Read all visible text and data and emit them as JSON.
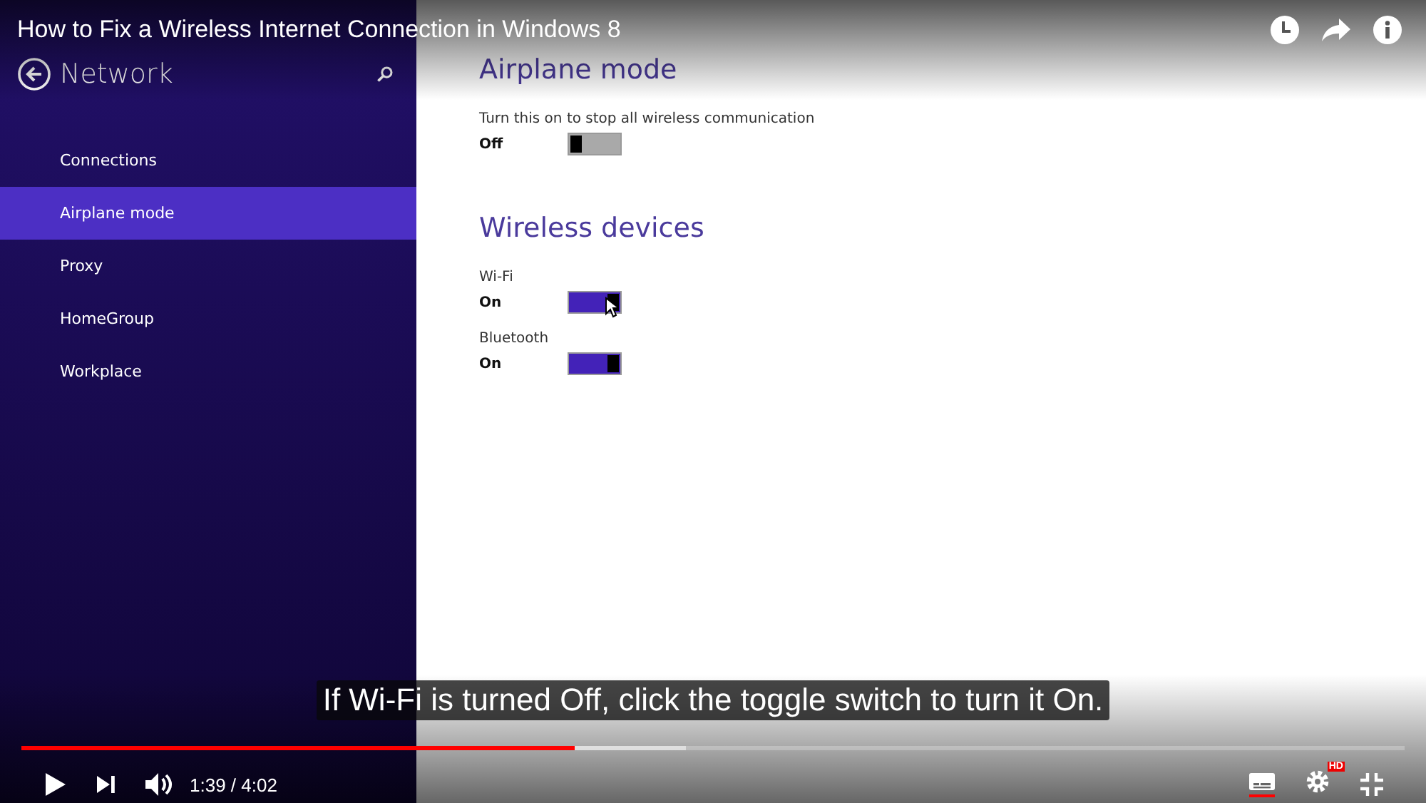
{
  "video": {
    "title": "How to Fix a Wireless Internet Connection in Windows 8"
  },
  "sidebar": {
    "title": "Network",
    "items": [
      {
        "label": "Connections",
        "selected": false
      },
      {
        "label": "Airplane mode",
        "selected": true
      },
      {
        "label": "Proxy",
        "selected": false
      },
      {
        "label": "HomeGroup",
        "selected": false
      },
      {
        "label": "Workplace",
        "selected": false
      }
    ]
  },
  "sections": [
    {
      "heading": "Airplane mode",
      "settings": [
        {
          "label": "Turn this on to stop all wireless communication",
          "state": "Off",
          "on": false
        }
      ]
    },
    {
      "heading": "Wireless devices",
      "settings": [
        {
          "label": "Wi-Fi",
          "state": "On",
          "on": true,
          "pointer": true
        },
        {
          "label": "Bluetooth",
          "state": "On",
          "on": true
        }
      ]
    }
  ],
  "caption": "If Wi-Fi is turned Off, click the toggle switch to turn it On.",
  "player": {
    "progress": {
      "level": 0.4
    },
    "buffer": {
      "level": 0.48
    },
    "time": "1:39 / 4:02",
    "quality_badge": "HD"
  }
}
